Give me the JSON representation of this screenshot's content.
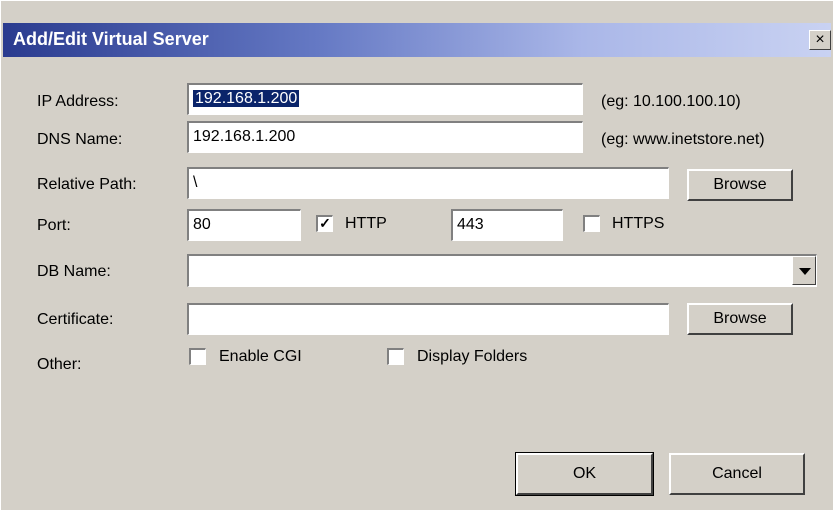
{
  "dialog": {
    "title": "Add/Edit Virtual Server",
    "close_glyph": "×"
  },
  "fields": {
    "ip_label": "IP Address:",
    "ip_value": "192.168.1.200",
    "ip_hint": "(eg: 10.100.100.10)",
    "dns_label": "DNS Name:",
    "dns_value": "192.168.1.200",
    "dns_hint": "(eg: www.inetstore.net)",
    "path_label": "Relative Path:",
    "path_value": "\\",
    "port_label": "Port:",
    "http_port": "80",
    "http_label": "HTTP",
    "http_checked": true,
    "https_port": "443",
    "https_label": "HTTPS",
    "https_checked": false,
    "db_label": "DB Name:",
    "db_value": "",
    "cert_label": "Certificate:",
    "cert_value": "",
    "other_label": "Other:",
    "cgi_label": "Enable CGI",
    "cgi_checked": false,
    "folders_label": "Display Folders",
    "folders_checked": false
  },
  "buttons": {
    "browse": "Browse",
    "ok": "OK",
    "cancel": "Cancel"
  },
  "icons": {
    "close": "close-icon",
    "dropdown": "chevron-down-icon",
    "check": "checkmark-icon"
  },
  "colors": {
    "selection": "#0a246a",
    "dialog_face": "#d4d0c8"
  }
}
